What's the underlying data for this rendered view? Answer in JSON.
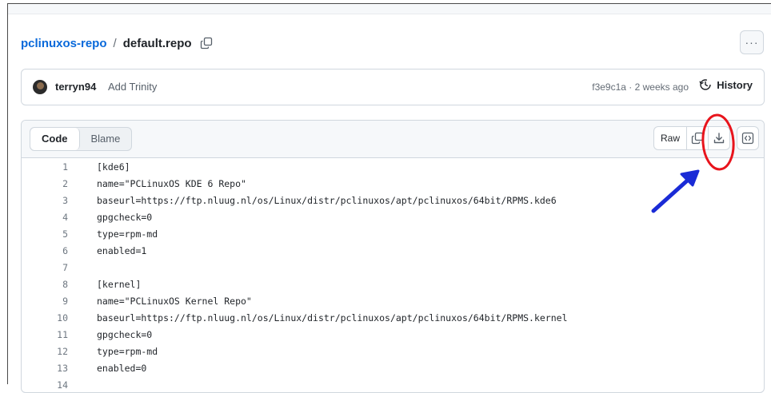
{
  "breadcrumb": {
    "repo": "pclinuxos-repo",
    "separator": "/",
    "file": "default.repo"
  },
  "more_menu": {
    "label": "···"
  },
  "commit": {
    "author": "terryn94",
    "message": "Add Trinity",
    "meta": "f3e9c1a · 2 weeks ago",
    "history_label": "History"
  },
  "file_header": {
    "tabs": [
      {
        "label": "Code",
        "active": true
      },
      {
        "label": "Blame",
        "active": false
      }
    ],
    "raw_label": "Raw"
  },
  "code_lines": [
    {
      "num": "1",
      "text": "[kde6]"
    },
    {
      "num": "2",
      "text": "name=\"PCLinuxOS KDE 6 Repo\""
    },
    {
      "num": "3",
      "text": "baseurl=https://ftp.nluug.nl/os/Linux/distr/pclinuxos/apt/pclinuxos/64bit/RPMS.kde6"
    },
    {
      "num": "4",
      "text": "gpgcheck=0"
    },
    {
      "num": "5",
      "text": "type=rpm-md"
    },
    {
      "num": "6",
      "text": "enabled=1"
    },
    {
      "num": "7",
      "text": ""
    },
    {
      "num": "8",
      "text": "[kernel]"
    },
    {
      "num": "9",
      "text": "name=\"PCLinuxOS Kernel Repo\""
    },
    {
      "num": "10",
      "text": "baseurl=https://ftp.nluug.nl/os/Linux/distr/pclinuxos/apt/pclinuxos/64bit/RPMS.kernel"
    },
    {
      "num": "11",
      "text": "gpgcheck=0"
    },
    {
      "num": "12",
      "text": "type=rpm-md"
    },
    {
      "num": "13",
      "text": "enabled=0"
    },
    {
      "num": "14",
      "text": ""
    }
  ],
  "icons": {
    "copy_path": "copy-icon",
    "history": "history-icon",
    "copy_raw": "copy-icon",
    "download": "download-icon",
    "symbols": "code-square-icon"
  },
  "annotation": {
    "ellipse_color": "#e8141c",
    "arrow_color": "#1a2bd6"
  },
  "colors": {
    "link": "#0969da",
    "border": "#d0d7de",
    "header_bg": "#f6f8fa"
  }
}
